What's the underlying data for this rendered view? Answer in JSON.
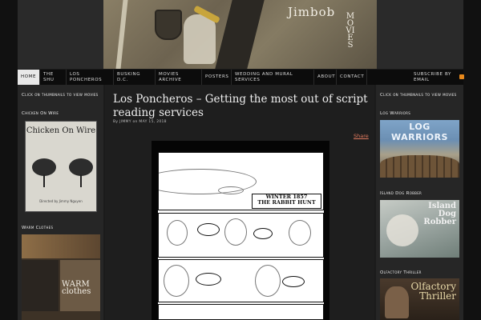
{
  "header": {
    "brand_title": "Jimbob",
    "brand_sub": "MOVIES"
  },
  "nav": {
    "items": [
      {
        "label": "Home",
        "active": true
      },
      {
        "label": "The Shu"
      },
      {
        "label": "Los Poncheros"
      },
      {
        "label": "Busking D.C."
      },
      {
        "label": "Movies Archive"
      },
      {
        "label": "Posters"
      },
      {
        "label": "Wedding and Mural Services"
      },
      {
        "label": "About"
      },
      {
        "label": "Contact"
      },
      {
        "label": "Subscribe by Email"
      }
    ]
  },
  "left_sidebar": {
    "intro": "Click on thumbnails to view movies",
    "widget1_title": "Chicken On Wire",
    "poster1_title": "Chicken On Wire",
    "poster1_credit": "Directed by Jimmy Nguyen",
    "widget2_title": "Warm Clothes",
    "poster2_title": "WARM clothes"
  },
  "post": {
    "title": "Los Poncheros – Getting the most out of script reading services",
    "meta": "By JIMMY on MAY 15, 2018",
    "share": "Share",
    "comic_caption_line1": "WINTER 1857",
    "comic_caption_line2": "THE RABBIT HUNT"
  },
  "right_sidebar": {
    "intro": "Click on thumbnails to view movies",
    "widget1_title": "Log Warriors",
    "poster1_title": "LOG WARRIORS",
    "widget2_title": "Island Dog Robber",
    "poster2_title": "Island Dog Robber",
    "widget3_title": "Olfactory Thriller",
    "poster3_title": "Olfactory Thriller"
  },
  "colors": {
    "accent_link": "#e07a5f",
    "nav_active_bg": "#e8e8e8",
    "rss": "#e8891c"
  }
}
